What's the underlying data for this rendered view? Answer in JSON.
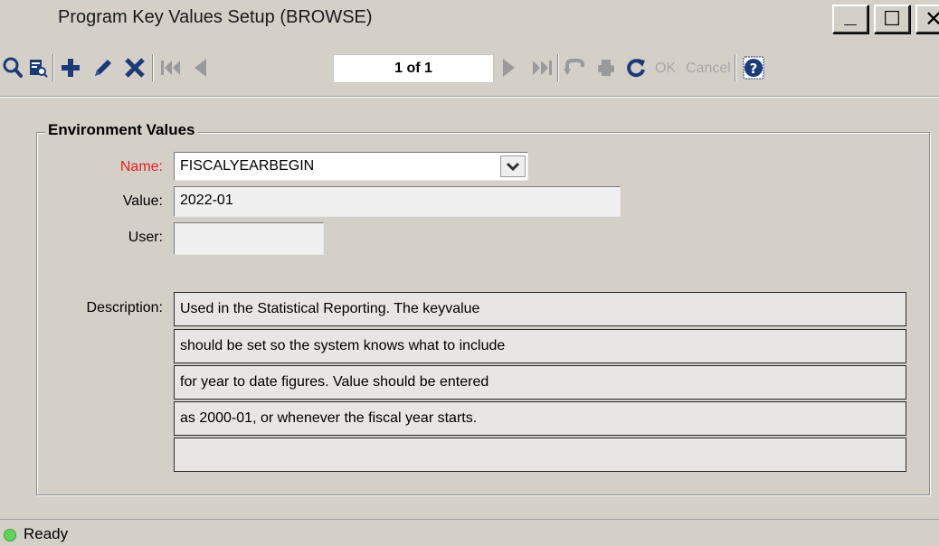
{
  "window": {
    "title": "Program Key Values Setup (BROWSE)",
    "minimize_label": "_",
    "maximize_label": "☐",
    "close_label": "✕"
  },
  "toolbar": {
    "record_position": "1 of 1",
    "ok_label": "OK",
    "cancel_label": "Cancel",
    "icons": [
      "search-icon",
      "preview-icon",
      "add-icon",
      "edit-icon",
      "delete-icon",
      "first-record-icon",
      "previous-record-icon",
      "next-record-icon",
      "last-record-icon",
      "undo-icon",
      "print-icon",
      "refresh-icon",
      "help-icon"
    ]
  },
  "group": {
    "title": "Environment Values"
  },
  "form": {
    "name_label": "Name:",
    "name_value": "FISCALYEARBEGIN",
    "value_label": "Value:",
    "value_value": "2022-01",
    "user_label": "User:",
    "user_value": "",
    "description_label": "Description:",
    "description_lines": [
      "Used in the Statistical Reporting. The keyvalue",
      "should be set so the system knows what to include",
      "for year to date figures. Value should be entered",
      "as 2000-01, or whenever the fiscal year starts.",
      ""
    ]
  },
  "status": {
    "text": "Ready",
    "indicator_color": "#5fd35a"
  },
  "colors": {
    "toolbar_icon": "#1b3b78",
    "required_label": "#e02020",
    "background": "#d4d0c8"
  }
}
